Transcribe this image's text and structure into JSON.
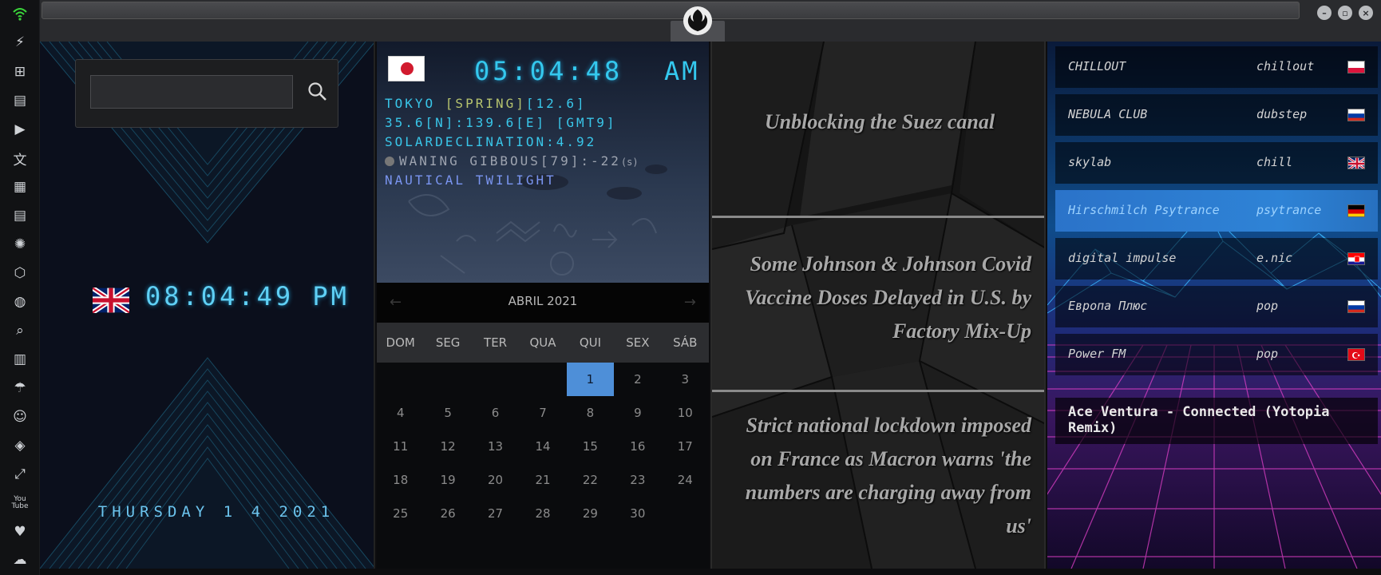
{
  "iconbar": {
    "icons": [
      "wifi-icon",
      "lightning-icon",
      "windows-icon",
      "archive-icon",
      "play-icon",
      "translate-icon",
      "image-icon",
      "news-icon",
      "aperture-icon",
      "hexagon-icon",
      "globe-icon",
      "search-icon",
      "map-icon",
      "umbrella-icon",
      "contact-icon",
      "code-icon",
      "expand-icon",
      "youtube-icon",
      "heart-icon",
      "cloud-icon"
    ],
    "glyphs": [
      "⚡",
      "⊞",
      "▤",
      "▶",
      "文",
      "▦",
      "▤",
      "✺",
      "⬡",
      "◍",
      "⌕",
      "▥",
      "☂",
      "☺",
      "◈",
      "⤢",
      "▶",
      "♥",
      "☁"
    ],
    "youtube_label": "You Tube"
  },
  "window": {
    "minimize_glyph": "–",
    "maximize_glyph": "▫",
    "close_glyph": "×"
  },
  "uk_clock": {
    "search_placeholder": "",
    "search_value": "",
    "time": "08:04:49 PM",
    "date": "THURSDAY 1 4 2021"
  },
  "tokyo": {
    "time": "05:04:48",
    "ampm": "AM",
    "city_prefix": "TOKYO ",
    "season": "[SPRING]",
    "temp": "[12.6]",
    "coords": "35.6[N]:139.6[E] [GMT9]",
    "declination": "SOLARDECLINATION:4.92",
    "moon": "WANING GIBBOUS[79]:-22",
    "moon_unit": "(s)",
    "twilight": "NAUTICAL TWILIGHT"
  },
  "calendar": {
    "month": "ABRIL 2021",
    "prev": "←",
    "next": "→",
    "day_names": [
      "DOM",
      "SEG",
      "TER",
      "QUA",
      "QUI",
      "SEX",
      "SÁB"
    ],
    "days": [
      "",
      "",
      "",
      "",
      "1",
      "2",
      "3",
      "4",
      "5",
      "6",
      "7",
      "8",
      "9",
      "10",
      "11",
      "12",
      "13",
      "14",
      "15",
      "16",
      "17",
      "18",
      "19",
      "20",
      "21",
      "22",
      "23",
      "24",
      "25",
      "26",
      "27",
      "28",
      "29",
      "30"
    ],
    "today": "1"
  },
  "news": {
    "items": [
      "Unblocking the Suez canal",
      "Some Johnson & Johnson Covid Vaccine Doses Delayed in U.S. by Factory Mix-Up",
      "Strict national lockdown imposed on France as Macron warns 'the numbers are charging away from us'"
    ]
  },
  "radio": {
    "stations": [
      {
        "name": "CHILLOUT",
        "genre": "chillout",
        "flag": "pl",
        "active": false
      },
      {
        "name": "NEBULA CLUB",
        "genre": "dubstep",
        "flag": "ru",
        "active": false
      },
      {
        "name": "skylab",
        "genre": "chill",
        "flag": "uk",
        "active": false
      },
      {
        "name": "Hirschmilch Psytrance",
        "genre": "psytrance",
        "flag": "de",
        "active": true
      },
      {
        "name": "digital impulse",
        "genre": "e.nic",
        "flag": "hr",
        "active": false
      },
      {
        "name": "Европа Плюс",
        "genre": "pop",
        "flag": "ru",
        "active": false
      },
      {
        "name": "Power FM",
        "genre": "pop",
        "flag": "tr",
        "active": false
      }
    ],
    "now_playing": "Ace Ventura - Connected (Yotopia Remix)"
  },
  "colors": {
    "accent_cyan": "#34c8ee",
    "calendar_today": "#4e8fd8",
    "active_station": "#2b73c9"
  }
}
